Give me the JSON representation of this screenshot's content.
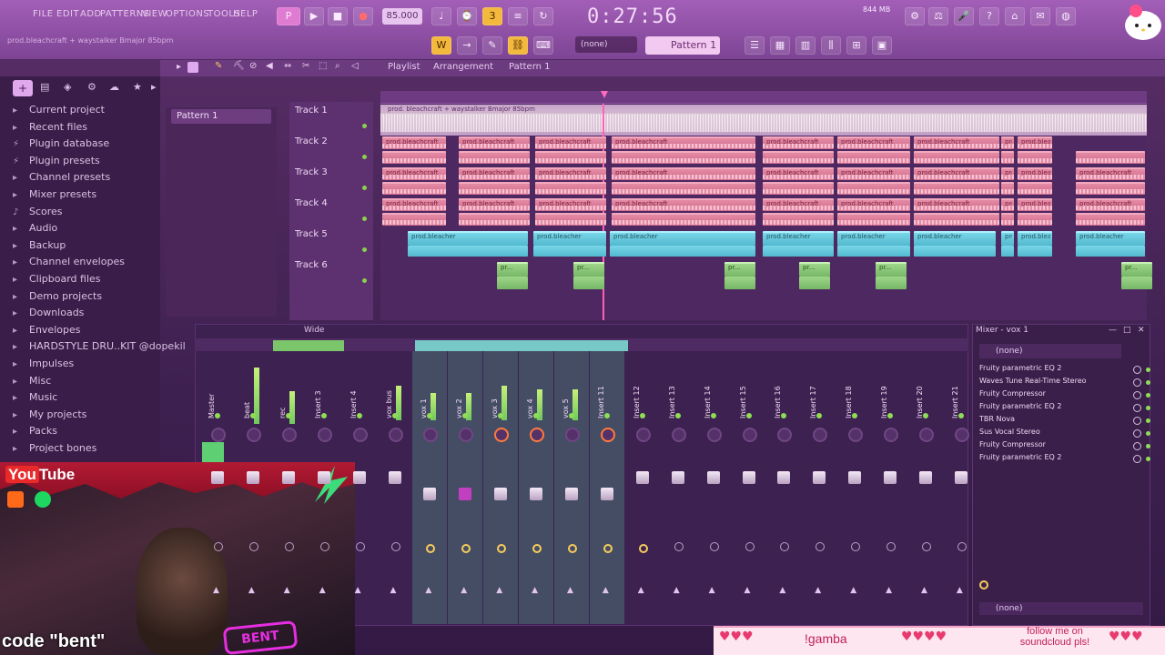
{
  "menu": [
    "FILE",
    "EDIT",
    "ADD",
    "PATTERNS",
    "VIEW",
    "OPTIONS",
    "TOOLS",
    "HELP"
  ],
  "transport": {
    "bpm": "85.000",
    "time": "0:27:56",
    "pattern": "Pattern 1",
    "none_select": "(none)",
    "cpu": "844 MB"
  },
  "hint": "prod.bleachcraft + waystalker Bmajor 85bpm",
  "sidebar": {
    "items": [
      {
        "label": "Current project",
        "icon": "folder-icon"
      },
      {
        "label": "Recent files",
        "icon": "folder-icon"
      },
      {
        "label": "Plugin database",
        "icon": "plug-icon"
      },
      {
        "label": "Plugin presets",
        "icon": "plug-icon"
      },
      {
        "label": "Channel presets",
        "icon": "folder-icon"
      },
      {
        "label": "Mixer presets",
        "icon": "folder-icon"
      },
      {
        "label": "Scores",
        "icon": "music-icon"
      },
      {
        "label": "Audio",
        "icon": "folder-icon"
      },
      {
        "label": "Backup",
        "icon": "folder-icon"
      },
      {
        "label": "Channel envelopes",
        "icon": "folder-icon"
      },
      {
        "label": "Clipboard files",
        "icon": "folder-icon"
      },
      {
        "label": "Demo projects",
        "icon": "folder-icon"
      },
      {
        "label": "Downloads",
        "icon": "folder-icon"
      },
      {
        "label": "Envelopes",
        "icon": "folder-icon"
      },
      {
        "label": "HARDSTYLE DRU..KIT @dopekil",
        "icon": "folder-icon"
      },
      {
        "label": "Impulses",
        "icon": "folder-icon"
      },
      {
        "label": "Misc",
        "icon": "folder-icon"
      },
      {
        "label": "Music",
        "icon": "folder-icon"
      },
      {
        "label": "My projects",
        "icon": "folder-icon"
      },
      {
        "label": "Packs",
        "icon": "folder-icon"
      },
      {
        "label": "Project bones",
        "icon": "folder-icon"
      }
    ]
  },
  "playlist": {
    "title": "Playlist",
    "breadcrumb": [
      "Arrangement",
      "Pattern 1"
    ],
    "patterns": [
      "Pattern 1"
    ],
    "tracks": [
      "Track 1",
      "Track 2",
      "Track 3",
      "Track 4",
      "Track 5",
      "Track 6"
    ],
    "master_clip": "prod. bleachcraft + waystalker Bmajor 85bpm",
    "pink_clip": "prod.bleachcraft",
    "cyan_clip": "prod.bleacher",
    "green_clip": "pr..."
  },
  "mixer": {
    "title": "Wide",
    "strips": [
      "Master",
      "beat",
      "rec",
      "Insert 3",
      "Insert 4",
      "vox bus",
      "vox 1",
      "vox 2",
      "vox 3",
      "vox 4",
      "vox 5",
      "Insert 11",
      "Insert 12",
      "Insert 13",
      "Insert 14",
      "Insert 15",
      "Insert 16",
      "Insert 17",
      "Insert 18",
      "Insert 19",
      "Insert 20",
      "Insert 21"
    ]
  },
  "insert_panel": {
    "title": "Mixer - vox 1",
    "preset": "(none)",
    "slots": [
      "Fruity parametric EQ 2",
      "Waves Tune Real-Time Stereo",
      "Fruity Compressor",
      "Fruity parametric EQ 2",
      "TBR Nova",
      "Sus Vocal Stereo",
      "Fruity Compressor",
      "Fruity parametric EQ 2"
    ],
    "out": "(none)"
  },
  "overlay": {
    "youtube": "Tube",
    "youtube_badge": "You",
    "code": "code \"bent\"",
    "bent_logo": "BENT",
    "gamba": "!gamba",
    "follow": "follow me on soundcloud pls!"
  },
  "colors": {
    "accent": "#f3b93c",
    "pink_clip": "#e48aa4",
    "cyan_clip": "#78d6e8",
    "green_clip": "#9ed58a"
  }
}
